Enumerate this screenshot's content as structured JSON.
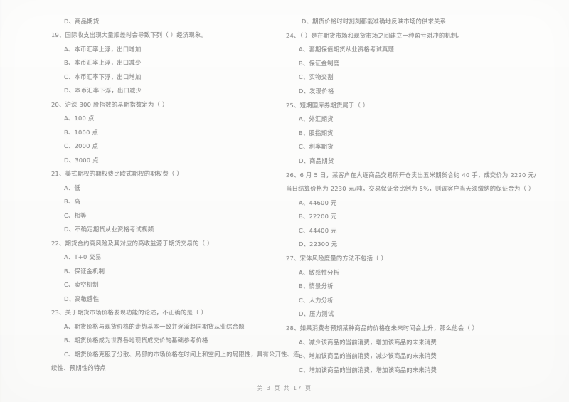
{
  "document": {
    "type": "scanned-exam-paper",
    "footer": "第 3 页  共 17 页",
    "ink_color": "#8d8d8d",
    "paper_color": "#fdfdfc"
  },
  "left_column": {
    "orphan_option": "D、商品期货",
    "questions": [
      {
        "number": "19",
        "stem": "19、国际收支出现大量顺差时会导致下列（        ）经济现象。",
        "options": [
          "A、本币汇率上浮，出口增加",
          "B、本币汇率上浮，出口减少",
          "C、本币汇率下浮，出口增加",
          "D、本币汇率下浮，出口减少"
        ]
      },
      {
        "number": "20",
        "stem": "20、沪深 300 股指数的基期指数定为（        ）",
        "options": [
          "A、100 点",
          "B、1000 点",
          "C、2000 点",
          "D、3000 点"
        ]
      },
      {
        "number": "21",
        "stem": "21、美式期权的期权费比欧式期权的期权费（        ）",
        "options": [
          "A、低",
          "B、高",
          "C、相等",
          "D、不确定期货从业资格考试视频"
        ]
      },
      {
        "number": "22",
        "stem": "22、期货合约高风险及其对应的高收益源于期货交易的（        ）",
        "options": [
          "A、T+0 交易",
          "B、保证金机制",
          "C、卖空机制",
          "D、高敏感性"
        ]
      },
      {
        "number": "23",
        "stem": "23、关于期货市场价格发现功能的论述，不正确的是（        ）",
        "options": [
          "A、期货价格与现货价格的走势基本一致并逐渐趋同期货从业综合题",
          "B、期货价格成为世界各地现货成交价的基础参考价格",
          "C、期货价格克服了分散、局部的市场价格在时间上和空间上的局限性，具有公开性、连"
        ],
        "continuation": "续性、预期性的特点"
      }
    ]
  },
  "right_column": {
    "orphan_option": "D、期货价格时时刻刻都能准确地反映市场的供求关系",
    "questions": [
      {
        "number": "24",
        "stem": "24、（        ）是在期货市场和现货市场之间建立一种盈亏对冲的机制。",
        "options": [
          "A、套期保值期货从业资格考试真题",
          "B、保证金制度",
          "C、实物交割",
          "D、发现价格"
        ]
      },
      {
        "number": "25",
        "stem": "25、短期国库券期货属于（        ）",
        "options": [
          "A、外汇期货",
          "B、股指期货",
          "C、利率期货",
          "D、商品期货"
        ]
      },
      {
        "number": "26",
        "stem": "26、6 月 5 日，某客户在大连商品交易所开仓卖出五米期货合约 40 手，成交价为 2220 元/",
        "continuation": "当日结算价格为 2230 元/吨，交易保证金比例为 5%，则该客户当天须缴纳的保证金为（        ）",
        "options": [
          "A、44600 元",
          "B、22200 元",
          "C、44400 元",
          "D、22300 元"
        ]
      },
      {
        "number": "27",
        "stem": "27、宋体风险度量的方法不包括（        ）",
        "options": [
          "A、敏感性分析",
          "B、情景分析",
          "C、人力分析",
          "D、压力测试"
        ]
      },
      {
        "number": "28",
        "stem": "28、如果消费者预期某种商品的价格在未来时间会上升，那么他会（        ）",
        "options": [
          "A、减少该商品的当前消费，增加该商品的未来消费",
          "B、增加该商品的当前消费，减少该商品的未来消费",
          "C、增加该商品的当前消费，增加该商品的未来消费"
        ]
      }
    ]
  }
}
